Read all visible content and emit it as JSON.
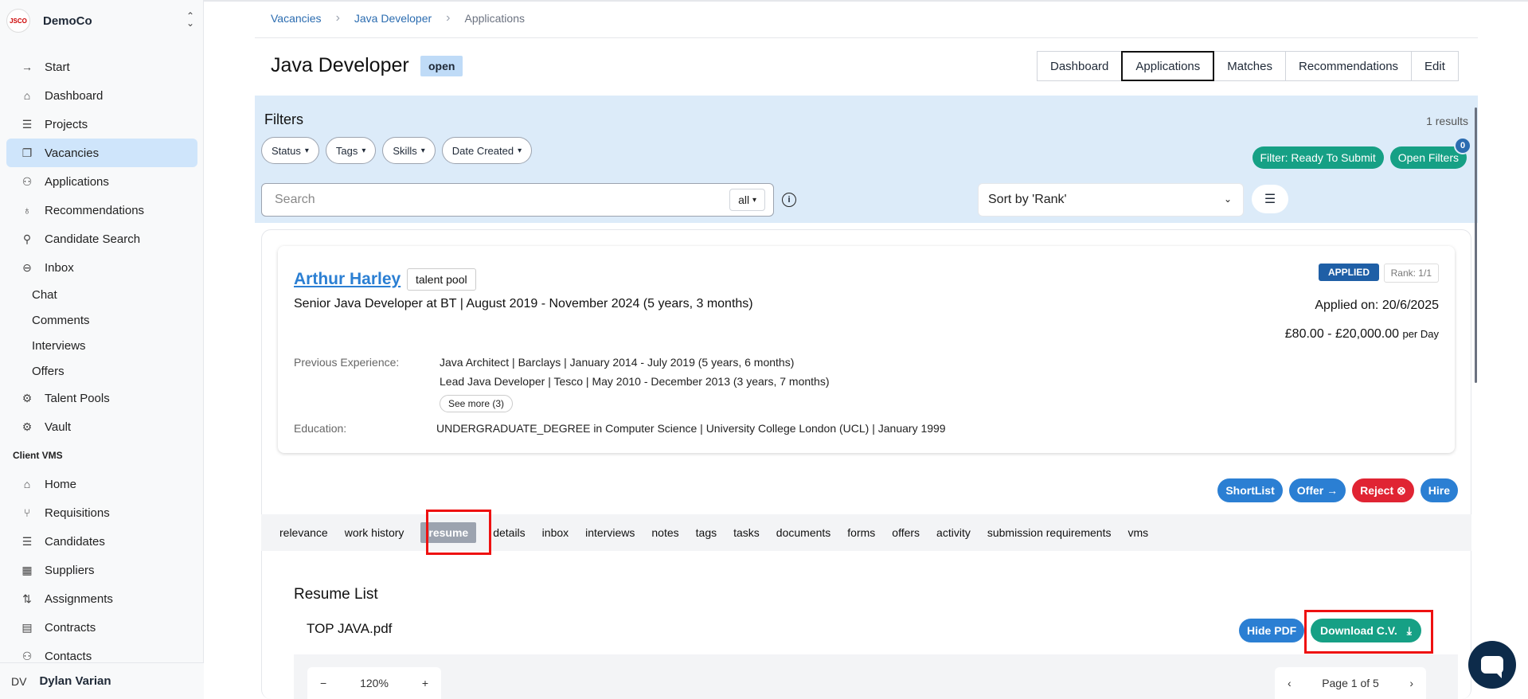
{
  "org": {
    "logo": "JSCO",
    "name": "DemoCo"
  },
  "sidebar": {
    "items": [
      {
        "label": "Start",
        "icon": "arrow-right-icon"
      },
      {
        "label": "Dashboard",
        "icon": "home-icon"
      },
      {
        "label": "Projects",
        "icon": "layers-icon"
      },
      {
        "label": "Vacancies",
        "icon": "copy-icon",
        "active": true
      },
      {
        "label": "Applications",
        "icon": "users-icon"
      },
      {
        "label": "Recommendations",
        "icon": "lightbulb-icon"
      },
      {
        "label": "Candidate Search",
        "icon": "search-icon"
      },
      {
        "label": "Inbox",
        "icon": "chat-icon"
      }
    ],
    "inbox_sub": [
      "Chat",
      "Comments",
      "Interviews",
      "Offers"
    ],
    "items2": [
      {
        "label": "Talent Pools",
        "icon": "gear-icon"
      },
      {
        "label": "Vault",
        "icon": "gear-icon"
      }
    ],
    "section": "Client VMS",
    "items3": [
      {
        "label": "Home",
        "icon": "home-icon"
      },
      {
        "label": "Requisitions",
        "icon": "git-branch-icon"
      },
      {
        "label": "Candidates",
        "icon": "layers-icon"
      },
      {
        "label": "Suppliers",
        "icon": "building-icon"
      },
      {
        "label": "Assignments",
        "icon": "git-pull-icon"
      },
      {
        "label": "Contracts",
        "icon": "file-icon"
      },
      {
        "label": "Contacts",
        "icon": "users-icon"
      }
    ]
  },
  "user": {
    "initials": "DV",
    "name": "Dylan Varian"
  },
  "breadcrumb": [
    "Vacancies",
    "Java Developer",
    "Applications"
  ],
  "page": {
    "title": "Java Developer",
    "status": "open"
  },
  "top_tabs": [
    "Dashboard",
    "Applications",
    "Matches",
    "Recommendations",
    "Edit"
  ],
  "filters": {
    "title": "Filters",
    "results": "1 results",
    "chips": [
      "Status",
      "Tags",
      "Skills",
      "Date Created"
    ],
    "ready_btn": "Filter: Ready To Submit",
    "open_btn": "Open Filters",
    "open_count": "0",
    "search_placeholder": "Search",
    "search_scope": "all",
    "sort": "Sort by 'Rank'"
  },
  "candidate": {
    "name": "Arthur Harley",
    "tag": "talent pool",
    "role": "Senior Java Developer at BT | August 2019 - November 2024 (5 years, 3 months)",
    "status": "APPLIED",
    "rank": "Rank: 1/1",
    "applied_on": "Applied on: 20/6/2025",
    "rate": "£80.00 - £20,000.00",
    "rate_unit": "per Day",
    "prev_label": "Previous Experience:",
    "prev": [
      "Java Architect | Barclays | January 2014 - July 2019 (5 years, 6 months)",
      "Lead Java Developer | Tesco | May 2010 - December 2013 (3 years, 7 months)"
    ],
    "see_more": "See more (3)",
    "edu_label": "Education:",
    "edu": "UNDERGRADUATE_DEGREE in Computer Science | University College London (UCL) | January 1999"
  },
  "actions": {
    "shortlist": "ShortList",
    "offer": "Offer",
    "reject": "Reject",
    "hire": "Hire"
  },
  "sub_tabs": [
    "relevance",
    "work history",
    "resume",
    "details",
    "inbox",
    "interviews",
    "notes",
    "tags",
    "tasks",
    "documents",
    "forms",
    "offers",
    "activity",
    "submission requirements",
    "vms"
  ],
  "resume": {
    "title": "Resume List",
    "file": "TOP JAVA.pdf",
    "hide_pdf": "Hide PDF",
    "download": "Download C.V.",
    "zoom": "120%",
    "page": "Page 1 of 5"
  }
}
